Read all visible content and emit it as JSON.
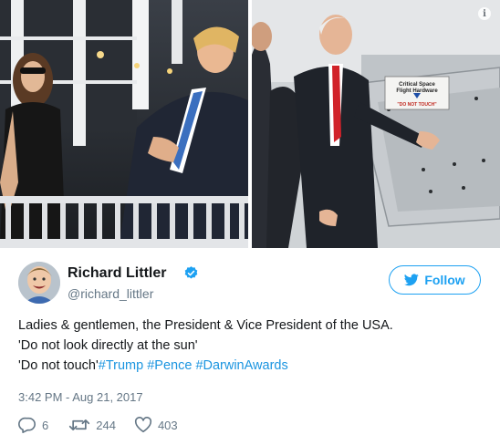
{
  "author": {
    "name": "Richard Littler",
    "handle": "@richard_littler",
    "verified": true
  },
  "follow_button": {
    "label": "Follow"
  },
  "photo_left_icon": "info-icon",
  "photo_right_sign": {
    "line1": "Critical Space",
    "line2": "Flight Hardware",
    "line3": "\"DO NOT TOUCH\""
  },
  "tweet": {
    "line1": "Ladies & gentlemen, the President & Vice President of the USA.",
    "line2": "'Do not look directly at the sun'",
    "line3_prefix": "'Do not touch'",
    "hashtags": [
      "#Trump",
      "#Pence",
      "#DarwinAwards"
    ]
  },
  "timestamp": "3:42 PM - Aug 21, 2017",
  "actions": {
    "replies": "6",
    "retweets": "244",
    "likes": "403"
  },
  "colors": {
    "link": "#1b95e0",
    "follow": "#1da1f2",
    "meta": "#657786"
  }
}
